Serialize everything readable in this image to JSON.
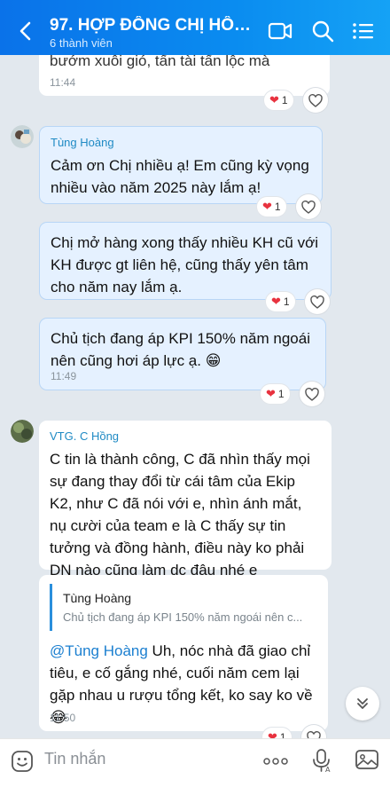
{
  "header": {
    "title": "97. HỢP ĐỒNG CHỊ HỒN...",
    "subtitle": "6 thành viên",
    "icons": [
      "back-icon",
      "video-call-icon",
      "search-icon",
      "menu-icon"
    ]
  },
  "messages": [
    {
      "text": "bướm xuôi gió, tấn tài tấn lộc mà",
      "time": "11:44",
      "reaction_count": "1"
    },
    {
      "sender": "Tùng Hoàng",
      "text": "Cảm ơn Chị nhiều ạ! Em cũng kỳ vọng nhiều vào năm 2025 này lắm ạ!",
      "reaction_count": "1"
    },
    {
      "text": "Chị mở hàng xong thấy nhiều KH cũ với KH được gt liên hệ, cũng thấy yên tâm cho năm nay lắm ạ.",
      "reaction_count": "1"
    },
    {
      "text": "Chủ tịch đang áp KPI 150% năm ngoái nên cũng hơi áp lực ạ. 😁",
      "time": "11:49",
      "reaction_count": "1"
    },
    {
      "sender": "VTG. C Hồng",
      "text": "C tin là thành công, C đã nhìn thấy mọi sự đang thay đổi từ cái tâm của Ekip K2, như C đã nói với e, nhìn ánh mắt, nụ cười của team e là C thấy sự tin tưởng và đồng hành, điều này ko phải DN nào cũng làm dc đâu nhé e"
    },
    {
      "quote_name": "Tùng Hoàng",
      "quote_text": "Chủ tịch đang áp KPI 150% năm ngoái nên c...",
      "mention": "@Tùng Hoàng",
      "text": " Uh, nóc nhà đã giao chỉ tiêu, e cố gắng nhé, cuối năm cem lại gặp nhau u rượu tổng kết, ko say ko về",
      "emoji": "😂",
      "time": "11:50",
      "reaction_count": "1"
    }
  ],
  "input": {
    "placeholder": "Tin nhắn"
  },
  "colors": {
    "header": "#0a7ce9",
    "background": "#e2e8ee",
    "mine_bubble": "#e5f1ff",
    "sender_name": "#1f8ac4",
    "heart": "#e8323f"
  }
}
